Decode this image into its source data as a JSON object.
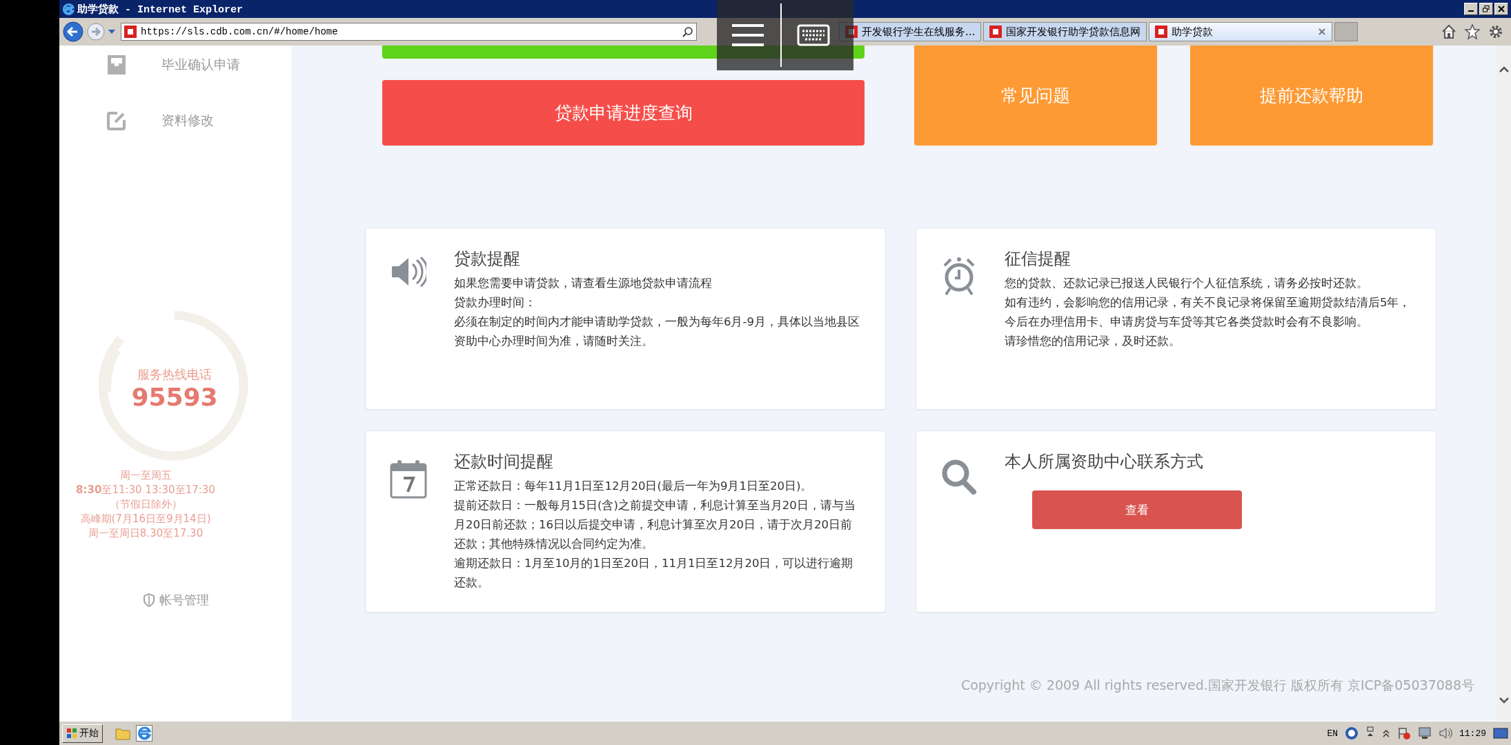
{
  "window": {
    "title": "助学贷款 - Internet Explorer"
  },
  "browser": {
    "url": "https://sls.cdb.com.cn/#/home/home",
    "tabs": [
      {
        "label": "开发银行学生在线服务...",
        "selected": false
      },
      {
        "label": "国家开发银行助学贷款信息网",
        "selected": false
      },
      {
        "label": "助学贷款",
        "selected": true
      }
    ]
  },
  "sidebar": {
    "items": [
      {
        "label": "毕业确认申请",
        "kind": "inbox"
      },
      {
        "label": "资料修改",
        "kind": "edit"
      }
    ],
    "hotline": {
      "label": "服务热线电话",
      "number": "95593",
      "hours": [
        "周一至周五",
        "**8:30**至11:30 13:30至17:30",
        "（节假日除外）",
        "高峰期(7月16日至9月14日)",
        "周一至周日8.30至17.30"
      ]
    },
    "account": "帐号管理"
  },
  "quick_buttons": [
    {
      "color": "#5fd31a"
    },
    {
      "label": "贷款申请进度查询",
      "color": "#f54e4a"
    },
    {
      "label": "常见问题",
      "color": "#fd9a34"
    },
    {
      "label": "提前还款帮助",
      "color": "#fd9a34"
    }
  ],
  "cards": [
    {
      "kind": "speaker",
      "title": "贷款提醒",
      "lines": [
        "如果您需要申请贷款，请查看生源地贷款申请流程",
        "贷款办理时间：",
        "必须在制定的时间内才能申请助学贷款，一般为每年6月-9月，具体以当地县区资助中心办理时间为准，请随时关注。"
      ]
    },
    {
      "kind": "alarm",
      "title": "征信提醒",
      "lines": [
        "您的贷款、还款记录已报送人民银行个人征信系统，请务必按时还款。",
        "如有违约，会影响您的信用记录，有关不良记录将保留至逾期贷款结清后5年，今后在办理信用卡、申请房贷与车贷等其它各类贷款时会有不良影响。",
        "请珍惜您的信用记录，及时还款。"
      ]
    },
    {
      "kind": "calendar",
      "title": "还款时间提醒",
      "lines": [
        "正常还款日：每年11月1日至12月20日(最后一年为9月1日至20日)。",
        "提前还款日：一般每月15日(含)之前提交申请，利息计算至当月20日，请与当月20日前还款；16日以后提交申请，利息计算至次月20日，请于次月20日前还款；其他特殊情况以合同约定为准。",
        "逾期还款日：1月至10月的1日至20日，11月1日至12月20日，可以进行逾期还款。"
      ]
    },
    {
      "kind": "search",
      "title": "本人所属资助中心联系方式",
      "button": "查看"
    }
  ],
  "footer": {
    "copyright": "Copyright © 2009 All rights reserved.国家开发银行 版权所有 京ICP备05037088号"
  },
  "taskbar": {
    "start": "开始",
    "language": "EN",
    "clock": "11:29"
  }
}
